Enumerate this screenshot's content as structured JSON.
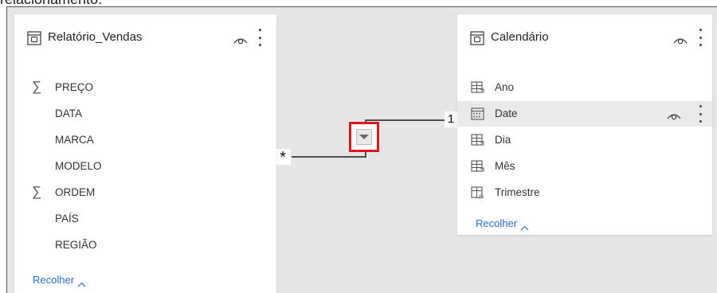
{
  "caption": "relacionamento:",
  "tables": [
    {
      "title": "Relatório_Vendas",
      "fields": [
        {
          "name": "PREÇO",
          "type": "sum"
        },
        {
          "name": "DATA",
          "type": "plain"
        },
        {
          "name": "MARCA",
          "type": "plain"
        },
        {
          "name": "MODELO",
          "type": "plain"
        },
        {
          "name": "ORDEM",
          "type": "sum"
        },
        {
          "name": "PAÍS",
          "type": "plain"
        },
        {
          "name": "REGIÃO",
          "type": "plain"
        }
      ],
      "collapse_label": "Recolher"
    },
    {
      "title": "Calendário",
      "fields": [
        {
          "name": "Ano",
          "type": "hierarchy"
        },
        {
          "name": "Date",
          "type": "calendar",
          "selected": true
        },
        {
          "name": "Dia",
          "type": "hierarchy"
        },
        {
          "name": "Mês",
          "type": "hierarchy"
        },
        {
          "name": "Trimestre",
          "type": "function"
        }
      ],
      "collapse_label": "Recolher"
    }
  ],
  "relationship": {
    "from_cardinality": "*",
    "to_cardinality": "1"
  },
  "colors": {
    "canvas": "#e6e6e6",
    "link": "#2a6ec6",
    "highlight": "#e0151f"
  }
}
